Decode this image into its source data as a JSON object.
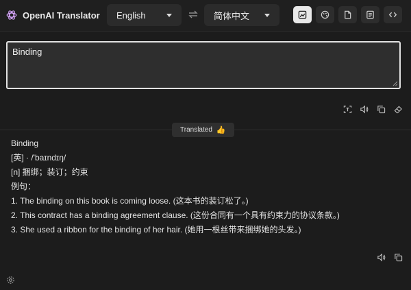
{
  "app": {
    "title": "OpenAI Translator",
    "logo_icon": "openai-logo-icon"
  },
  "languages": {
    "source": "English",
    "target": "简体中文",
    "swap_icon": "swap-arrows-icon"
  },
  "toolbar": {
    "buttons": [
      {
        "icon": "image-translate-icon",
        "active": true
      },
      {
        "icon": "palette-icon",
        "active": false
      },
      {
        "icon": "document-icon",
        "active": false
      },
      {
        "icon": "vocabulary-icon",
        "active": false
      },
      {
        "icon": "code-icon",
        "active": false
      }
    ]
  },
  "input": {
    "value": "Binding"
  },
  "input_actions": [
    "ocr-icon",
    "speaker-icon",
    "copy-icon",
    "eraser-icon"
  ],
  "status": {
    "label": "Translated",
    "emoji": "👍"
  },
  "result": {
    "lines": [
      "Binding",
      "[英] · /'baɪndɪŋ/",
      "[n] 捆绑；装订；约束",
      "例句：",
      "1. The binding on this book is coming loose. (这本书的装订松了。)",
      "2. This contract has a binding agreement clause. (这份合同有一个具有约束力的协议条款。)",
      "3. She used a ribbon for the binding of her hair. (她用一根丝带来捆绑她的头发。)"
    ]
  },
  "result_actions": [
    "speaker-icon",
    "copy-icon"
  ],
  "colors": {
    "background": "#1c1c1c",
    "accent": "#e9e9e9",
    "panel": "#2b2b2b"
  }
}
